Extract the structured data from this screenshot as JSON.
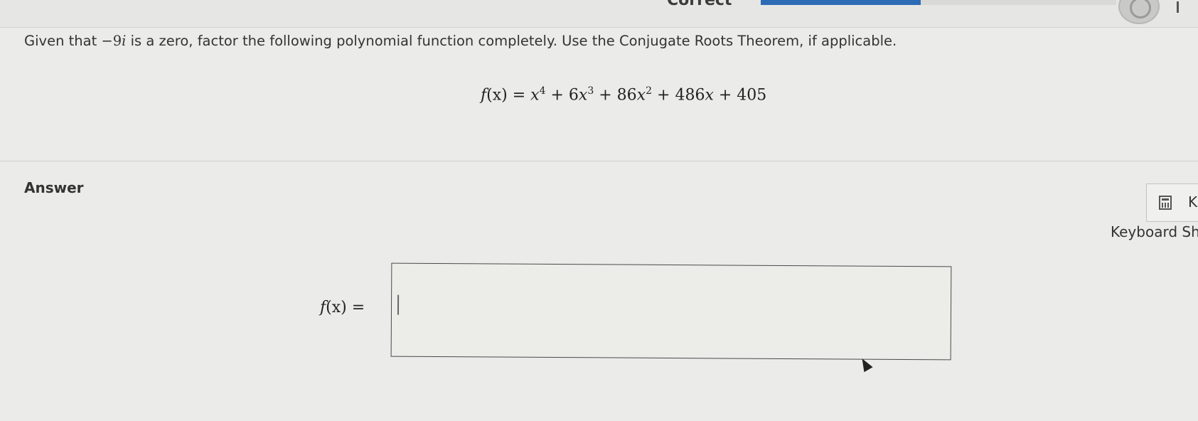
{
  "header": {
    "status_text": "Correct",
    "progress_percent": 45
  },
  "question": {
    "intro_before": "Given that ",
    "zero": "−9",
    "zero_i": "i",
    "intro_after": " is a zero, factor the following polynomial function completely. Use the Conjugate Roots Theorem, if applicable.",
    "equation": {
      "lhs_f": "f",
      "lhs_arg": "(x) = ",
      "x1": "x",
      "e1": "4",
      "t2": " + 6",
      "x2": "x",
      "e2": "3",
      "t3": " + 86",
      "x3": "x",
      "e3": "2",
      "t4": " + 486",
      "x4": "x",
      "t5": " + 405"
    }
  },
  "answer": {
    "label": "Answer",
    "input_f": "f",
    "input_arg": "(x) =",
    "input_value": ""
  },
  "sidebar": {
    "calculator_letter": "K",
    "keyboard_shortcuts_label": "Keyboard Sh"
  },
  "colors": {
    "accent": "#2e6bb5",
    "background": "#ebebe9"
  },
  "icons": [
    "calculator-icon",
    "mouse-pointer-icon"
  ]
}
